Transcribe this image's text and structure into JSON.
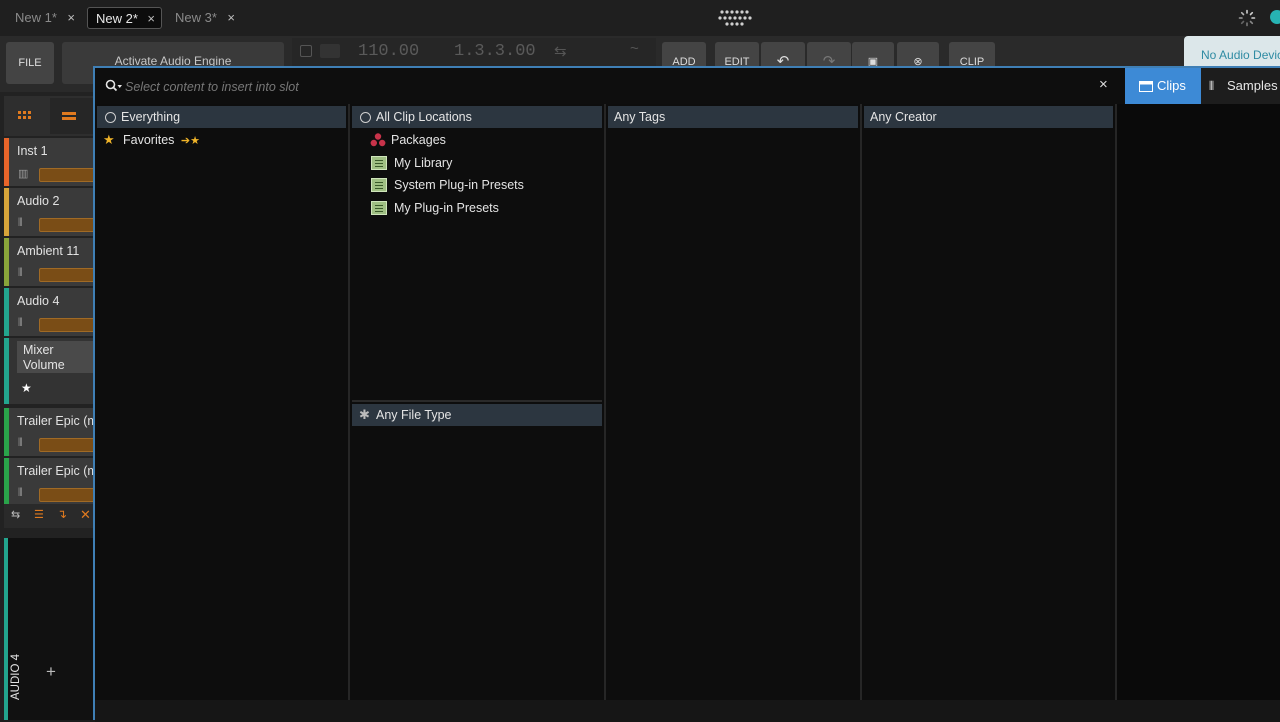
{
  "tabs": [
    {
      "label": "New 1*",
      "active": false
    },
    {
      "label": "New 2*",
      "active": true
    },
    {
      "label": "New 3*",
      "active": false
    }
  ],
  "toolbar": {
    "file": "FILE",
    "activate": "Activate Audio Engine",
    "tempo": "110.00",
    "position": "1.3.3.00",
    "add": "ADD",
    "edit": "EDIT",
    "clip": "CLIP",
    "no_audio": "No Audio Device"
  },
  "tracks": [
    {
      "name": "Inst 1",
      "color": "#e8652a",
      "icon": "piano-icon"
    },
    {
      "name": "Audio 2",
      "color": "#d7a53a",
      "icon": "waveform-icon"
    },
    {
      "name": "Ambient 11",
      "color": "#8aa53a",
      "icon": "waveform-icon"
    },
    {
      "name": "Audio 4",
      "color": "#23a58e",
      "icon": "waveform-icon"
    },
    {
      "name": "Trailer Epic (m",
      "color": "#2aa34a",
      "icon": "waveform-icon"
    },
    {
      "name": "Trailer Epic (m",
      "color": "#2aa34a",
      "icon": "waveform-icon"
    }
  ],
  "mixer": {
    "line1": "Mixer",
    "line2": "Volume"
  },
  "audio4_label": "AUDIO 4",
  "add_symbol": "+",
  "browser": {
    "search_placeholder": "Select content to insert into slot",
    "close_symbol": "×",
    "type_tabs": {
      "clips": "Clips",
      "samples": "Samples"
    },
    "columns": {
      "categories": {
        "header": "Everything",
        "items": [
          {
            "label": "Favorites",
            "icon": "star-icon"
          }
        ]
      },
      "locations": {
        "header": "All Clip Locations",
        "items": [
          {
            "label": "Packages",
            "icon": "packages-icon"
          },
          {
            "label": "My Library",
            "icon": "library-icon"
          },
          {
            "label": "System Plug-in Presets",
            "icon": "library-icon"
          },
          {
            "label": "My Plug-in Presets",
            "icon": "library-icon"
          }
        ],
        "filetype_header": "Any File Type"
      },
      "tags": {
        "header": "Any Tags"
      },
      "creator": {
        "header": "Any Creator"
      }
    }
  },
  "colors": {
    "accent": "#3d8ad6",
    "star": "#f0b429"
  }
}
